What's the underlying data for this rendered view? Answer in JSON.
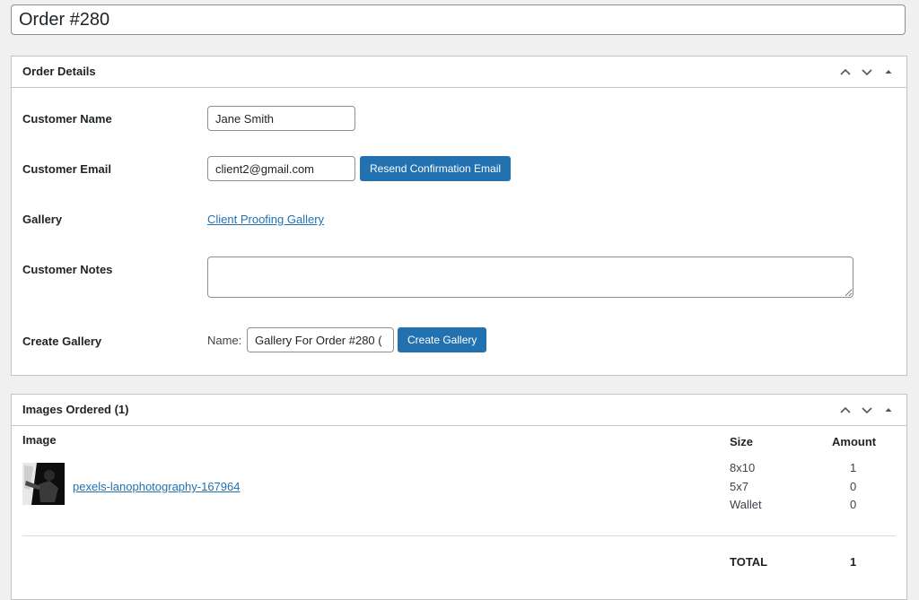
{
  "post_title": "Order #280",
  "order_details": {
    "title": "Order Details",
    "customer_name_label": "Customer Name",
    "customer_name_value": "Jane Smith",
    "customer_email_label": "Customer Email",
    "customer_email_value": "client2@gmail.com",
    "resend_button": "Resend Confirmation Email",
    "gallery_label": "Gallery",
    "gallery_link": "Client Proofing Gallery",
    "notes_label": "Customer Notes",
    "notes_value": "",
    "create_gallery_label": "Create Gallery",
    "name_label": "Name:",
    "gallery_name_value": "Gallery For Order #280 (",
    "create_gallery_button": "Create Gallery"
  },
  "images_ordered": {
    "title": "Images Ordered (1)",
    "columns": {
      "image": "Image",
      "size": "Size",
      "amount": "Amount"
    },
    "items": [
      {
        "name": "pexels-lanophotography-167964",
        "rows": [
          {
            "size": "8x10",
            "amount": "1"
          },
          {
            "size": "5x7",
            "amount": "0"
          },
          {
            "size": "Wallet",
            "amount": "0"
          }
        ]
      }
    ],
    "total_label": "TOTAL",
    "total_value": "1"
  },
  "icons": {
    "move_up": "chevron-up-icon",
    "move_down": "chevron-down-icon",
    "toggle": "triangle-up-icon"
  },
  "colors": {
    "primary": "#2271b1",
    "background": "#f0f0f1",
    "border": "#c3c4c7"
  }
}
